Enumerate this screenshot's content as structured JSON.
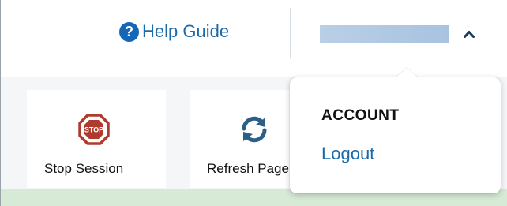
{
  "header": {
    "help": {
      "label": "Help Guide",
      "icon": "question-circle-icon"
    },
    "user_menu": {
      "chevron_icon": "chevron-up-icon"
    }
  },
  "toolbar": {
    "stop_session": {
      "label": "Stop Session",
      "icon": "stop-sign-icon",
      "icon_text": "STOP"
    },
    "refresh_page": {
      "label": "Refresh Page",
      "icon": "refresh-icon"
    }
  },
  "account_menu": {
    "heading": "ACCOUNT",
    "logout_label": "Logout"
  },
  "colors": {
    "link": "#1b6aa9",
    "help_icon": "#1466b8",
    "stop_sign": "#b03a2e",
    "refresh_icon": "#2c5f86",
    "bottom_band": "#d6ead6"
  }
}
